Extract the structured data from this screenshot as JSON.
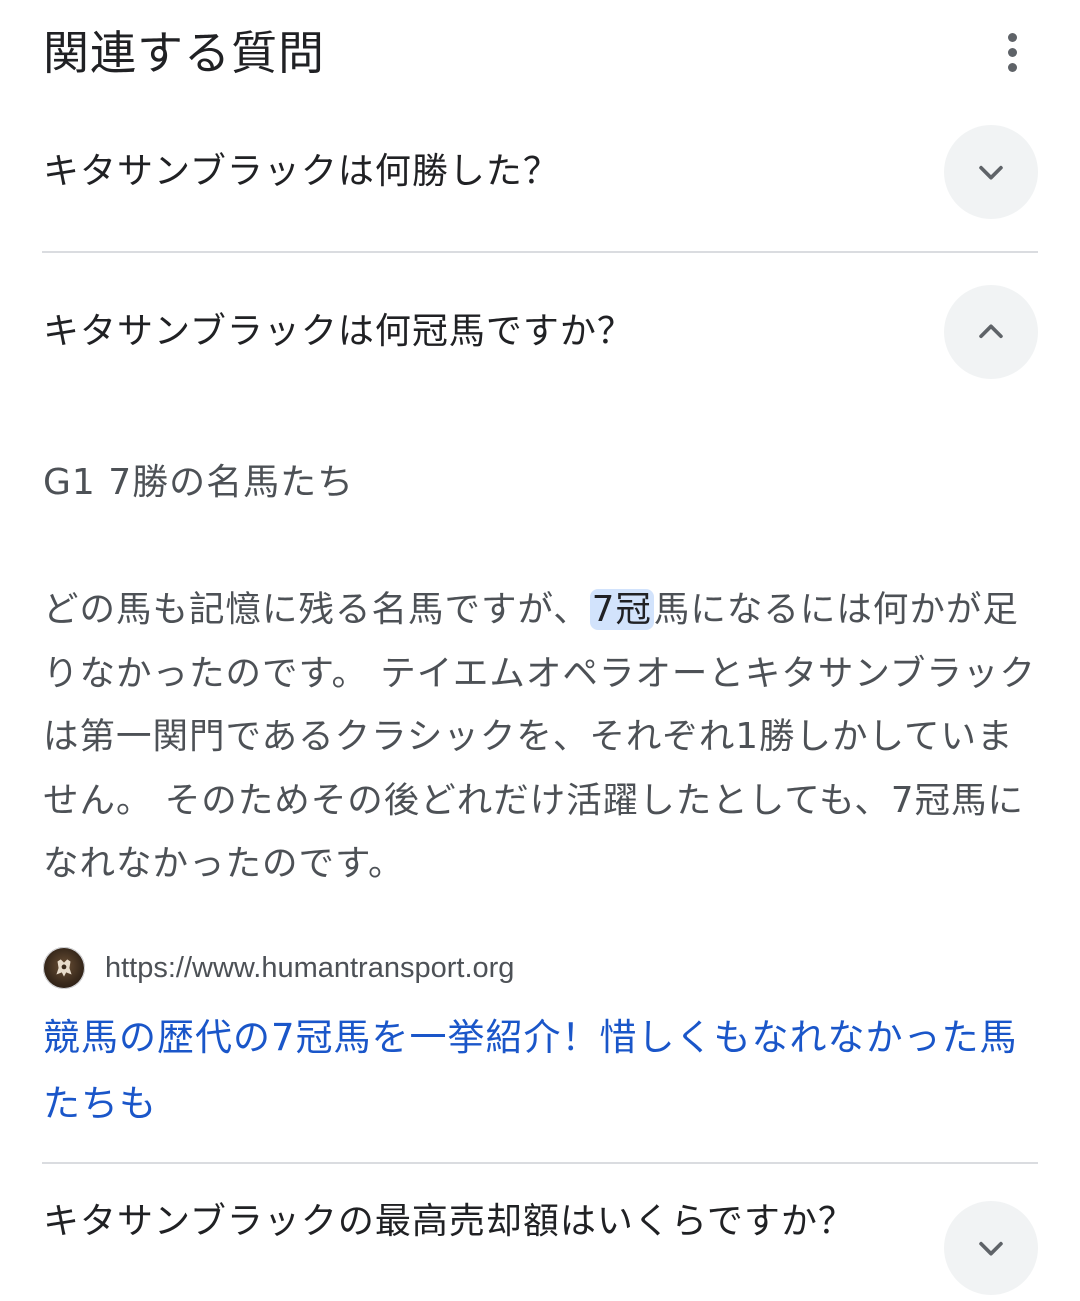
{
  "header": {
    "title": "関連する質問"
  },
  "questions": [
    {
      "text": "キタサンブラックは何勝した？",
      "expanded": false
    },
    {
      "text": "キタサンブラックは何冠馬ですか？",
      "expanded": true,
      "answer": {
        "heading": "G1 7勝の名馬たち",
        "body_before": "どの馬も記憶に残る名馬ですが、",
        "body_highlight": "7冠",
        "body_after": "馬になるには何かが足りなかったのです。 テイエムオペラオーとキタサンブラックは第一関門であるクラシックを、それぞれ1勝しかしていません。 そのためその後どれだけ活躍したとしても、7冠馬になれなかったのです。",
        "source_url": "https://www.humantransport.org",
        "source_title": "競馬の歴代の7冠馬を一挙紹介！惜しくもなれなかった馬たちも"
      }
    },
    {
      "text": "キタサンブラックの最高売却額はいくらですか？",
      "expanded": false
    }
  ],
  "icons": {
    "more": "more-vert-icon",
    "expand": "chevron-down-icon",
    "collapse": "chevron-up-icon",
    "favicon": "site-favicon"
  },
  "colors": {
    "highlight": "#d2e3fc",
    "link": "#1a56c9",
    "toggle_bg": "#f1f3f4"
  }
}
